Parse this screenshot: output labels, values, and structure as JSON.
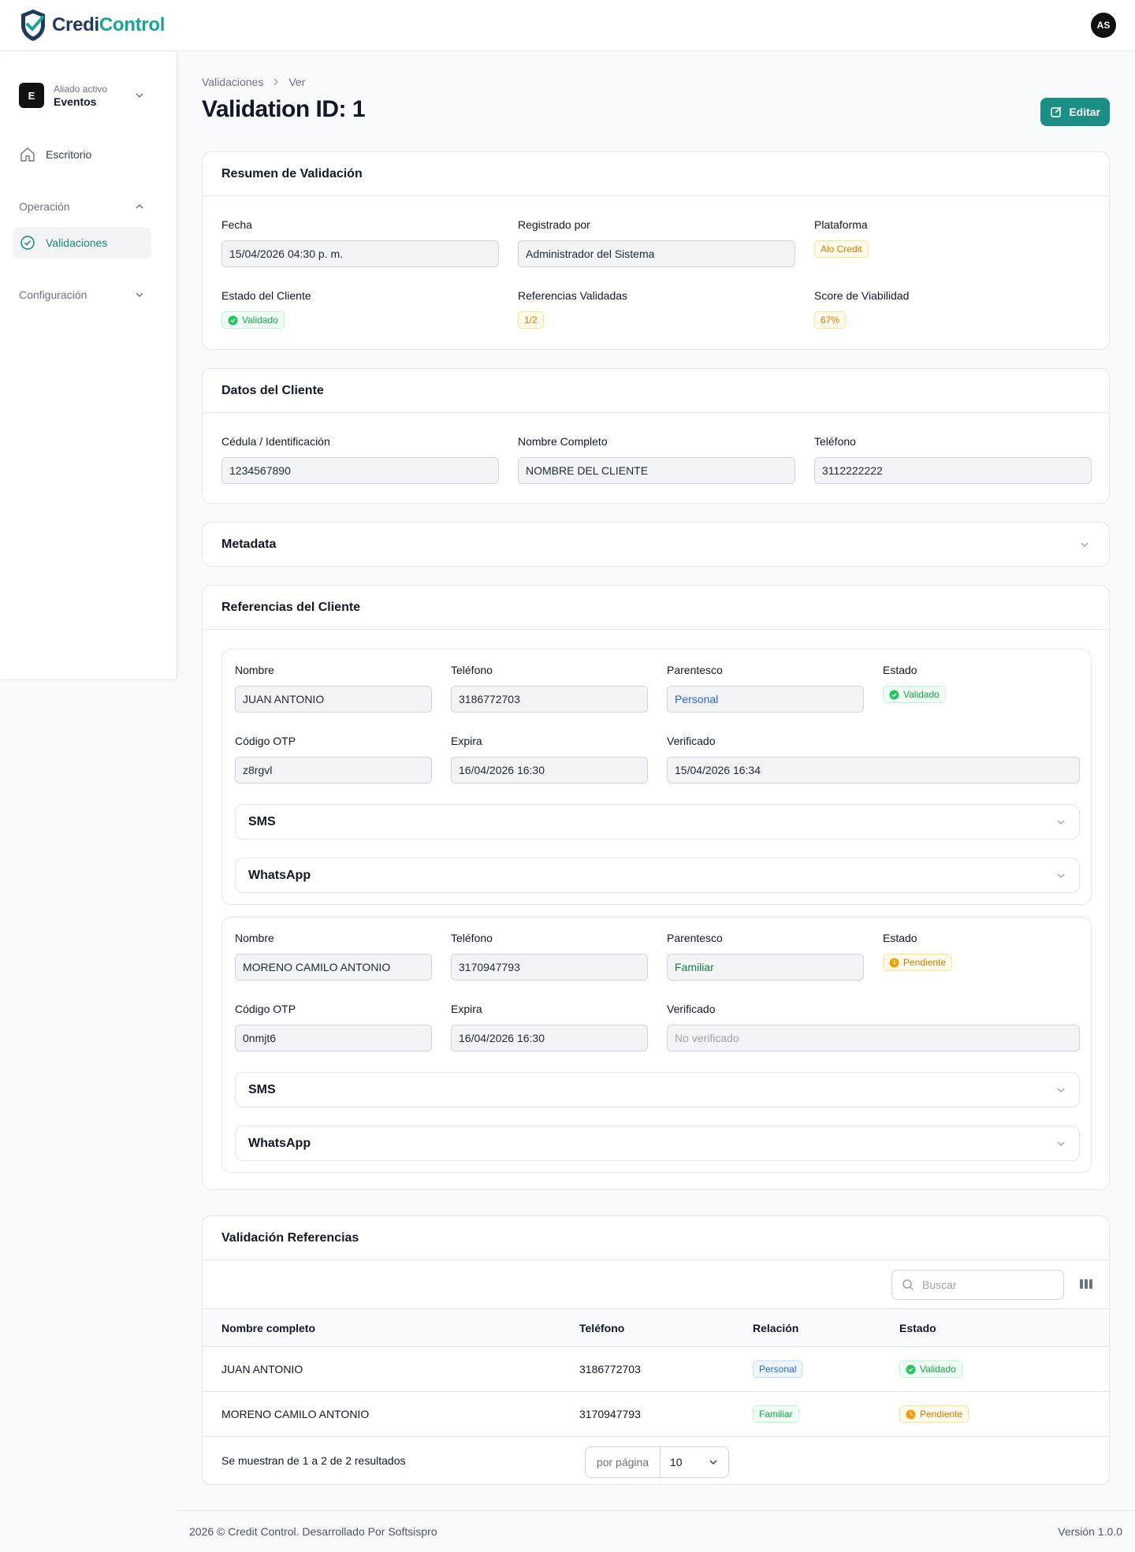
{
  "brand": {
    "name_part1": "Credi",
    "name_part2": "Control"
  },
  "user": {
    "initials": "AS"
  },
  "sidebar": {
    "tenant_label": "Aliado activo",
    "tenant_name": "Eventos",
    "tenant_initial": "E",
    "dashboard": "Escritorio",
    "group_operation": "Operación",
    "validations": "Validaciones",
    "group_config": "Configuración"
  },
  "header": {
    "breadcrumb": [
      "Validaciones",
      "Ver"
    ],
    "title": "Validation ID: 1",
    "edit_label": "Editar"
  },
  "summary": {
    "title": "Resumen de Validación",
    "date_label": "Fecha",
    "date_value": "15/04/2026 04:30 p. m.",
    "registered_label": "Registrado por",
    "registered_value": "Administrador del Sistema",
    "platform_label": "Plataforma",
    "platform_value": "Alo Credit",
    "client_status_label": "Estado del Cliente",
    "client_status_value": "Validado",
    "refs_label": "Referencias Validadas",
    "refs_value": "1/2",
    "score_label": "Score de Viabilidad",
    "score_value": "67%"
  },
  "client": {
    "title": "Datos del Cliente",
    "id_label": "Cédula / Identificación",
    "id_value": "1234567890",
    "name_label": "Nombre Completo",
    "name_value": "NOMBRE DEL CLIENTE",
    "phone_label": "Teléfono",
    "phone_value": "3112222222"
  },
  "metadata": {
    "title": "Metadata"
  },
  "references": {
    "title": "Referencias del Cliente",
    "labels": {
      "name": "Nombre",
      "phone": "Teléfono",
      "relation": "Parentesco",
      "status": "Estado",
      "otp": "Código OTP",
      "expires": "Expira",
      "verified": "Verificado",
      "sms": "SMS",
      "whatsapp": "WhatsApp"
    },
    "items": [
      {
        "name": "JUAN ANTONIO",
        "phone": "3186772703",
        "relation": "Personal",
        "status": "Validado",
        "otp": "z8rgvl",
        "expires": "16/04/2026 16:30",
        "verified": "15/04/2026 16:34"
      },
      {
        "name": "MORENO CAMILO ANTONIO",
        "phone": "3170947793",
        "relation": "Familiar",
        "status": "Pendiente",
        "otp": "0nmjt6",
        "expires": "16/04/2026 16:30",
        "verified": "No verificado"
      }
    ]
  },
  "table": {
    "title": "Validación Referencias",
    "search_placeholder": "Buscar",
    "columns": [
      "Nombre completo",
      "Teléfono",
      "Relación",
      "Estado"
    ],
    "rows": [
      {
        "name": "JUAN ANTONIO",
        "phone": "3186772703",
        "relation": "Personal",
        "status": "Validado"
      },
      {
        "name": "MORENO CAMILO ANTONIO",
        "phone": "3170947793",
        "relation": "Familiar",
        "status": "Pendiente"
      }
    ],
    "results_text": "Se muestran de 1 a 2 de 2 resultados",
    "per_page_label": "por página",
    "per_page_value": "10"
  },
  "footer": {
    "copyright": "2026 © Credit Control. Desarrollado Por Softsispro",
    "version": "Versión 1.0.0"
  },
  "colors": {
    "accent": "#1b8f86",
    "green": "#16a34a",
    "amber": "#d97706",
    "blue": "#2563eb"
  }
}
